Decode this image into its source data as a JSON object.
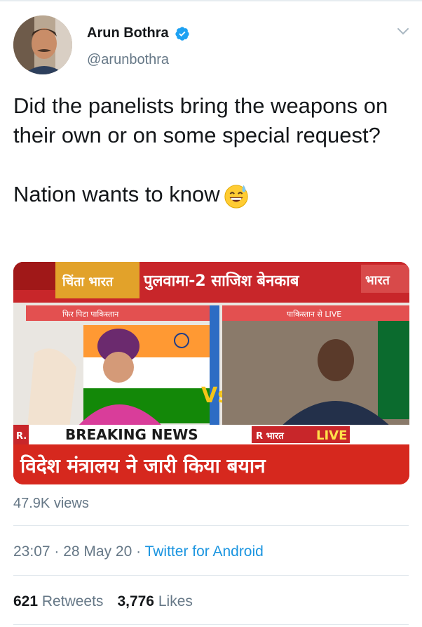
{
  "author": {
    "name": "Arun Bothra",
    "handle": "@arunbothra"
  },
  "tweet": {
    "line1": "Did the panelists bring the weapons on their own or on some special request?",
    "line2": "Nation wants to know"
  },
  "media": {
    "top_banner_left": "चिंता भारत",
    "top_banner": "पुलवामा-2 साजिश बेनकाब",
    "top_banner_right": "भारत",
    "left_caption": "फिर पिटा पाकिस्तान",
    "right_caption": "पाकिस्तान से LIVE",
    "vs": "Vs",
    "breaking_r": "R.",
    "breaking_label": "BREAKING NEWS",
    "live_label": "LIVE",
    "live_prefix": "R भारत",
    "headline": "विदेश मंत्रालय ने जारी किया बयान"
  },
  "stats": {
    "views": "47.9K views",
    "time": "23:07",
    "date": "28 May 20",
    "source": "Twitter for Android",
    "retweets_count": "621",
    "retweets_label": "Retweets",
    "likes_count": "3,776",
    "likes_label": "Likes"
  },
  "colors": {
    "link": "#1b95e0",
    "muted": "#657786",
    "verified": "#1da1f2"
  }
}
